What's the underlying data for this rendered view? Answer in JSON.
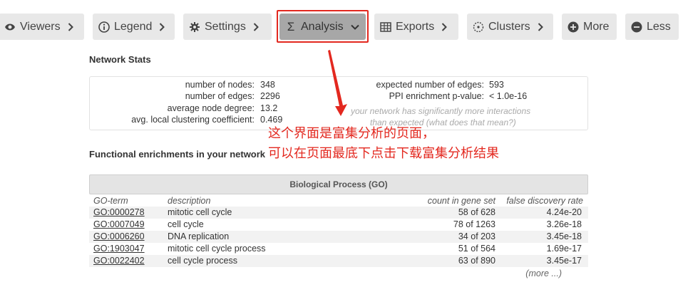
{
  "toolbar": {
    "viewers": "Viewers",
    "legend": "Legend",
    "settings": "Settings",
    "analysis": "Analysis",
    "exports": "Exports",
    "clusters": "Clusters",
    "more": "More",
    "less": "Less"
  },
  "network_stats": {
    "heading": "Network Stats",
    "nodes_label": "number of nodes:",
    "nodes_value": "348",
    "edges_label": "number of edges:",
    "edges_value": "2296",
    "degree_label": "average node degree:",
    "degree_value": "13.2",
    "clustering_label": "avg. local clustering coefficient:",
    "clustering_value": "0.469",
    "expected_label": "expected number of edges:",
    "expected_value": "593",
    "ppi_label": "PPI enrichment p-value:",
    "ppi_value": "< 1.0e-16",
    "note_line1": "your network has significantly more interactions",
    "note_line2": "than expected (what does that mean?)"
  },
  "annotation": {
    "line1": "这个界面是富集分析的页面，",
    "line2": "可以在页面最底下点击下载富集分析结果",
    "color": "#e3281f"
  },
  "enrichment": {
    "heading": "Functional enrichments in your network",
    "category": "Biological Process (GO)",
    "columns": {
      "term": "GO-term",
      "description": "description",
      "count": "count in gene set",
      "fdr": "false discovery rate"
    },
    "rows": [
      {
        "id": "GO:0000278",
        "description": "mitotic cell cycle",
        "count": "58 of 628",
        "fdr": "4.24e-20"
      },
      {
        "id": "GO:0007049",
        "description": "cell cycle",
        "count": "78 of 1263",
        "fdr": "3.26e-18"
      },
      {
        "id": "GO:0006260",
        "description": "DNA replication",
        "count": "34 of 203",
        "fdr": "3.45e-18"
      },
      {
        "id": "GO:1903047",
        "description": "mitotic cell cycle process",
        "count": "51 of 564",
        "fdr": "1.69e-17"
      },
      {
        "id": "GO:0022402",
        "description": "cell cycle process",
        "count": "63 of 890",
        "fdr": "3.45e-17"
      }
    ],
    "more": "(more ...)"
  }
}
